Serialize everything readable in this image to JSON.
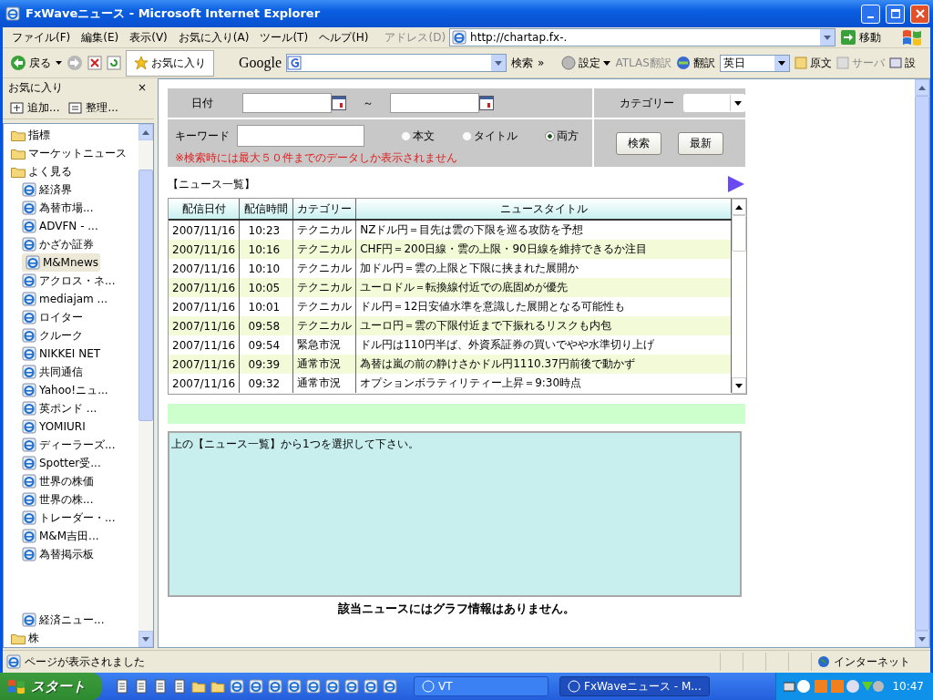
{
  "window": {
    "title": "FxWaveニュース - Microsoft Internet Explorer"
  },
  "menu": [
    "ファイル(F)",
    "編集(E)",
    "表示(V)",
    "お気に入り(A)",
    "ツール(T)",
    "ヘルプ(H)"
  ],
  "address": {
    "label": "アドレス(D)",
    "value": "http://chartap.fx-.",
    "go": "移動"
  },
  "toolbar": {
    "back": "戻る",
    "favorites": "お気に入り",
    "google_logo": "Google",
    "google_search": "検索",
    "more": "»",
    "settings": "設定",
    "atlas": "ATLAS翻訳",
    "translate": "翻訳",
    "language": "英日",
    "original": "原文",
    "server": "サーバ",
    "cut_item": "設"
  },
  "sidebar": {
    "title": "お気に入り",
    "close": "×",
    "add": "追加...",
    "organize": "整理...",
    "items": [
      {
        "label": "指標",
        "kind": "folder"
      },
      {
        "label": "マーケットニュース",
        "kind": "folder"
      },
      {
        "label": "よく見る",
        "kind": "folder",
        "children": [
          {
            "label": "経済界",
            "selected": false
          },
          {
            "label": "為替市場...",
            "selected": false
          },
          {
            "label": "ADVFN - ...",
            "selected": false
          },
          {
            "label": "かざか証券",
            "selected": false
          },
          {
            "label": "M&Mnews",
            "selected": true
          },
          {
            "label": "アクロス・ネ...",
            "selected": false
          },
          {
            "label": "mediajam ...",
            "selected": false
          },
          {
            "label": "ロイター",
            "selected": false
          },
          {
            "label": "クルーク",
            "selected": false
          },
          {
            "label": "NIKKEI NET",
            "selected": false
          },
          {
            "label": "共同通信",
            "selected": false
          },
          {
            "label": "Yahoo!ニュ...",
            "selected": false
          },
          {
            "label": "英ポンド ...",
            "selected": false
          },
          {
            "label": "YOMIURI",
            "selected": false
          },
          {
            "label": "ディーラーズ...",
            "selected": false
          },
          {
            "label": "Spotter受...",
            "selected": false
          },
          {
            "label": "世界の株価",
            "selected": false
          },
          {
            "label": "世界の株...",
            "selected": false
          },
          {
            "label": "トレーダー・...",
            "selected": false
          },
          {
            "label": "M&M吉田...",
            "selected": false
          },
          {
            "label": "為替掲示板",
            "selected": false
          },
          {
            "label": "経済ニュー...",
            "selected": false
          }
        ]
      },
      {
        "label": "株",
        "kind": "folder"
      }
    ]
  },
  "search_form": {
    "date_label": "日付",
    "tilde": "～",
    "category_label": "カテゴリー",
    "keyword_label": "キーワード",
    "scopes": [
      {
        "label": "本文",
        "selected": false
      },
      {
        "label": "タイトル",
        "selected": false
      },
      {
        "label": "両方",
        "selected": true
      }
    ],
    "buttons": [
      "検索",
      "最新"
    ],
    "warning": "※検索時には最大５０件までのデータしか表示されません"
  },
  "news_list": {
    "heading": "【ニュース一覧】",
    "columns": [
      "配信日付",
      "配信時間",
      "カテゴリー",
      "ニュースタイトル"
    ],
    "rows": [
      {
        "date": "2007/11/16",
        "time": "10:23",
        "category": "テクニカル",
        "title": "NZドル円＝目先は雲の下限を巡る攻防を予想"
      },
      {
        "date": "2007/11/16",
        "time": "10:16",
        "category": "テクニカル",
        "title": "CHF円＝200日線・雲の上限・90日線を維持できるか注目"
      },
      {
        "date": "2007/11/16",
        "time": "10:10",
        "category": "テクニカル",
        "title": "加ドル円＝雲の上限と下限に挟まれた展開か"
      },
      {
        "date": "2007/11/16",
        "time": "10:05",
        "category": "テクニカル",
        "title": "ユーロドル＝転換線付近での底固めが優先"
      },
      {
        "date": "2007/11/16",
        "time": "10:01",
        "category": "テクニカル",
        "title": "ドル円＝12日安値水準を意識した展開となる可能性も"
      },
      {
        "date": "2007/11/16",
        "time": "09:58",
        "category": "テクニカル",
        "title": "ユーロ円＝雲の下限付近まで下振れるリスクも内包"
      },
      {
        "date": "2007/11/16",
        "time": "09:54",
        "category": "緊急市況",
        "title": "ドル円は110円半ば、外資系証券の買いでやや水準切り上げ"
      },
      {
        "date": "2007/11/16",
        "time": "09:39",
        "category": "通常市況",
        "title": "為替は嵐の前の静けさかドル円1110.37円前後で動かず"
      },
      {
        "date": "2007/11/16",
        "time": "09:32",
        "category": "通常市況",
        "title": "オプションボラティリティー上昇＝9:30時点"
      }
    ]
  },
  "detail": {
    "message": "上の【ニュース一覧】から1つを選択して下さい。"
  },
  "graph_message": "該当ニュースにはグラフ情報はありません。",
  "status_bar": {
    "text": "ページが表示されました",
    "zone": "インターネット"
  },
  "taskbar": {
    "start": "スタート",
    "tasks": [
      {
        "label": "VT",
        "selected": false
      },
      {
        "label": "FxWaveニュース - M...",
        "selected": true
      }
    ],
    "clock": "10:47"
  }
}
